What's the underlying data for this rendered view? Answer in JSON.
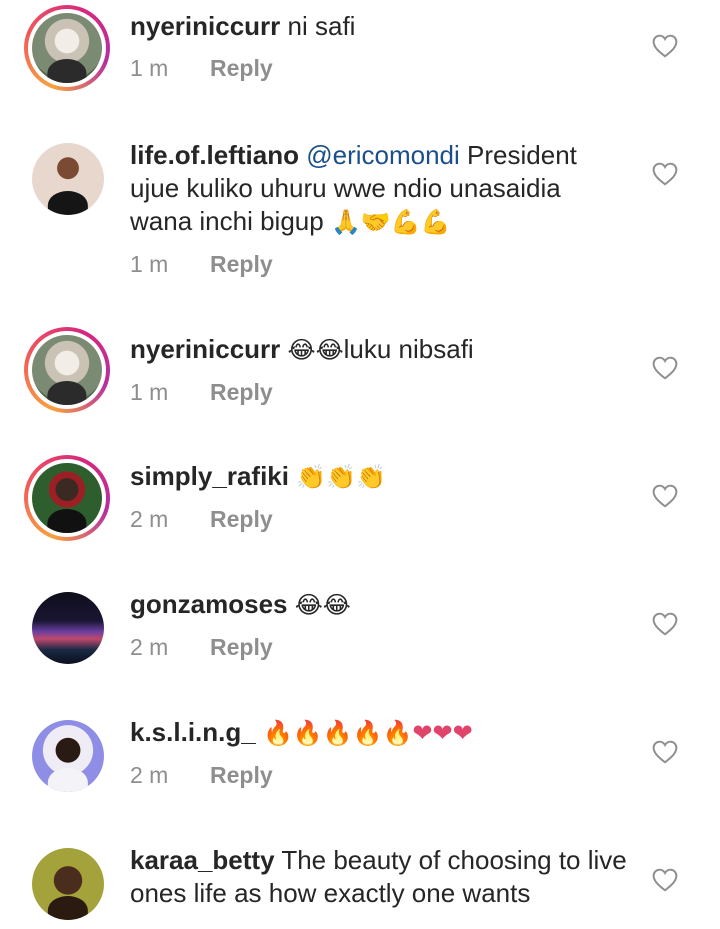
{
  "comments": [
    {
      "username": "nyeriniccurr",
      "mention": "",
      "text": "ni safi",
      "emoji": "",
      "time": "1 m",
      "reply_label": "Reply",
      "avatar": "avatar-nyeriniccurr",
      "story_ring": true
    },
    {
      "username": "life.of.leftiano",
      "mention": "@ericomondi",
      "text": "President ujue kuliko uhuru wwe ndio unasaidia wana inchi bigup",
      "emoji": "🙏🤝💪💪",
      "time": "1 m",
      "reply_label": "Reply",
      "avatar": "avatar-life-of-leftiano",
      "story_ring": false
    },
    {
      "username": "nyeriniccurr",
      "mention": "",
      "text": "luku nibsafi",
      "emoji_before": "😂😂",
      "time": "1 m",
      "reply_label": "Reply",
      "avatar": "avatar-nyeriniccurr",
      "story_ring": true
    },
    {
      "username": "simply_rafiki",
      "mention": "",
      "text": "",
      "emoji": "👏👏👏",
      "time": "2 m",
      "reply_label": "Reply",
      "avatar": "avatar-simply-rafiki",
      "story_ring": true
    },
    {
      "username": "gonzamoses",
      "mention": "",
      "text": "",
      "emoji": "😂😂",
      "time": "2 m",
      "reply_label": "Reply",
      "avatar": "avatar-gonzamoses",
      "story_ring": false
    },
    {
      "username": "k.s.l.i.n.g_",
      "mention": "",
      "text": "",
      "emoji": "🔥🔥🔥🔥🔥❤❤❤",
      "time": "2 m",
      "reply_label": "Reply",
      "avatar": "avatar-k-s-l-i-n-g",
      "story_ring": false
    },
    {
      "username": "karaa_betty",
      "mention": "",
      "text": "The beauty of choosing to live ones life as how exactly one wants",
      "emoji": "",
      "time": "",
      "reply_label": "",
      "avatar": "avatar-karaa-betty",
      "story_ring": false
    }
  ],
  "icons": {
    "like": "heart-outline-icon"
  },
  "colors": {
    "text": "#262626",
    "muted": "#8e8e8e",
    "mention": "#1a4f8a",
    "story_ring_start": "#f9a23f",
    "story_ring_end": "#b62fa0"
  }
}
